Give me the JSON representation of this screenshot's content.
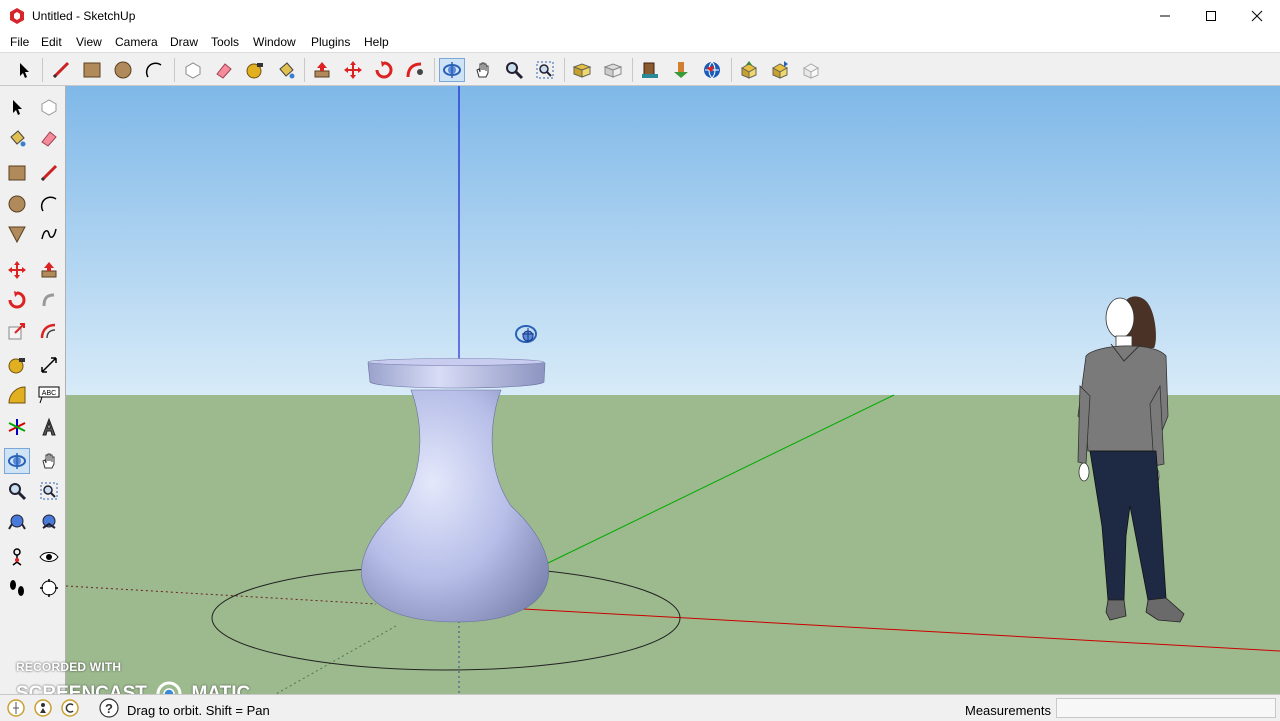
{
  "window": {
    "title": "Untitled - SketchUp",
    "controls": [
      "minimize",
      "maximize",
      "close"
    ]
  },
  "menu": [
    "File",
    "Edit",
    "View",
    "Camera",
    "Draw",
    "Tools",
    "Window",
    "Plugins",
    "Help"
  ],
  "toolbar": {
    "active_tool": "orbit",
    "tools": [
      "select",
      "line",
      "rectangle",
      "circle",
      "arc",
      "make-component",
      "eraser",
      "tape-measure",
      "paint-bucket",
      "push-pull",
      "move",
      "rotate",
      "follow-me",
      "orbit",
      "pan",
      "zoom",
      "zoom-extents",
      "previous-view",
      "next-view",
      "get-models",
      "share-model",
      "share-component",
      "3d-warehouse",
      "extension-warehouse",
      "layout"
    ]
  },
  "left_toolbar": {
    "tools": [
      "select",
      "make-component",
      "paint-bucket",
      "eraser",
      "rectangle",
      "line",
      "circle",
      "arc",
      "polygon",
      "freehand",
      "move",
      "push-pull",
      "rotate",
      "follow-me",
      "scale",
      "offset",
      "tape-measure",
      "dimension",
      "protractor",
      "text",
      "axes",
      "3d-text",
      "orbit",
      "pan",
      "zoom",
      "zoom-window",
      "zoom-extents",
      "previous",
      "position-camera",
      "look-around",
      "walk",
      "section-plane"
    ],
    "text_badge": "ABC"
  },
  "status": {
    "hint": "Drag to orbit.  Shift = Pan",
    "measurements_label": "Measurements",
    "measurements_value": ""
  },
  "watermark": {
    "line1": "RECORDED WITH",
    "line2a": "SCREENCAST",
    "line2b": "MATIC"
  },
  "colors": {
    "sky_top": "#7fb8e8",
    "sky_bottom": "#d8ebf8",
    "ground": "#9cba8e",
    "vase": "#b7bee8",
    "red_axis": "#cc0000",
    "green_axis": "#00aa00",
    "blue_axis": "#0000cc"
  }
}
